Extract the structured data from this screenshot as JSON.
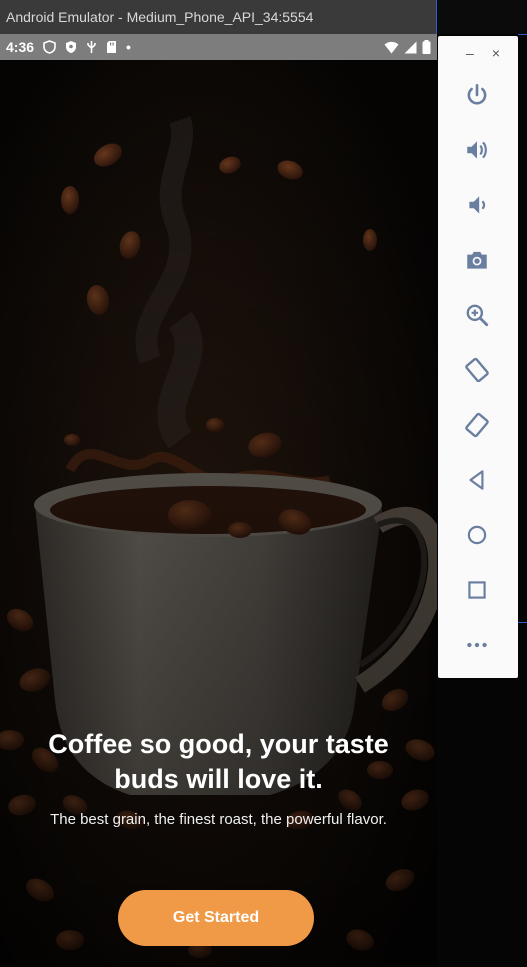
{
  "window": {
    "title": "Android Emulator - Medium_Phone_API_34:5554"
  },
  "statusbar": {
    "time": "4:36",
    "dot": "•"
  },
  "screen": {
    "headline": "Coffee so good, your taste buds will love it.",
    "subtitle": "The best grain, the finest roast, the powerful flavor.",
    "cta_label": "Get Started"
  },
  "toolbar": {
    "minimize": "–",
    "close": "×",
    "icons": [
      "power-icon",
      "volume-up-icon",
      "volume-down-icon",
      "camera-icon",
      "zoom-icon",
      "rotate-left-icon",
      "rotate-right-icon",
      "back-icon",
      "home-icon",
      "overview-icon",
      "more-icon"
    ]
  },
  "colors": {
    "accent": "#f09a48",
    "toolbar_icon": "#6a7fa0",
    "title_bar": "#3a3a3a",
    "status_bar": "#7d7d7d"
  }
}
